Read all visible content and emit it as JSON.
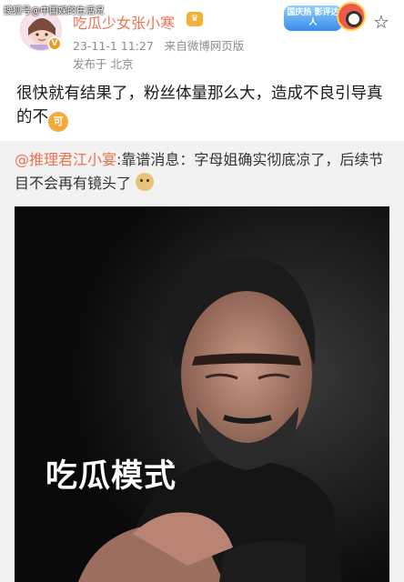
{
  "watermark": "搜狐号@中国娱的生活况",
  "post": {
    "username": "吃瓜少女张小寒",
    "user_badge_icon": "vip-badge-icon",
    "timestamp": "23-11-1 11:27",
    "source": "来自微博网页版",
    "location": "发布于 北京",
    "text": "很快就有结果了，粉丝体量那么大，造成不良引导真的不",
    "emoji_label": "可"
  },
  "promo_badge": {
    "label": "国庆热 影评达人"
  },
  "repost": {
    "user": "@推理君江小宴",
    "text": ":靠谱消息：字母姐确实彻底凉了，后续节目不会再有镜头了",
    "image_caption": "吃瓜模式"
  },
  "colors": {
    "accent": "#eb7350",
    "meta_gray": "#8c8c8c",
    "repost_bg": "#f2f2f2"
  }
}
